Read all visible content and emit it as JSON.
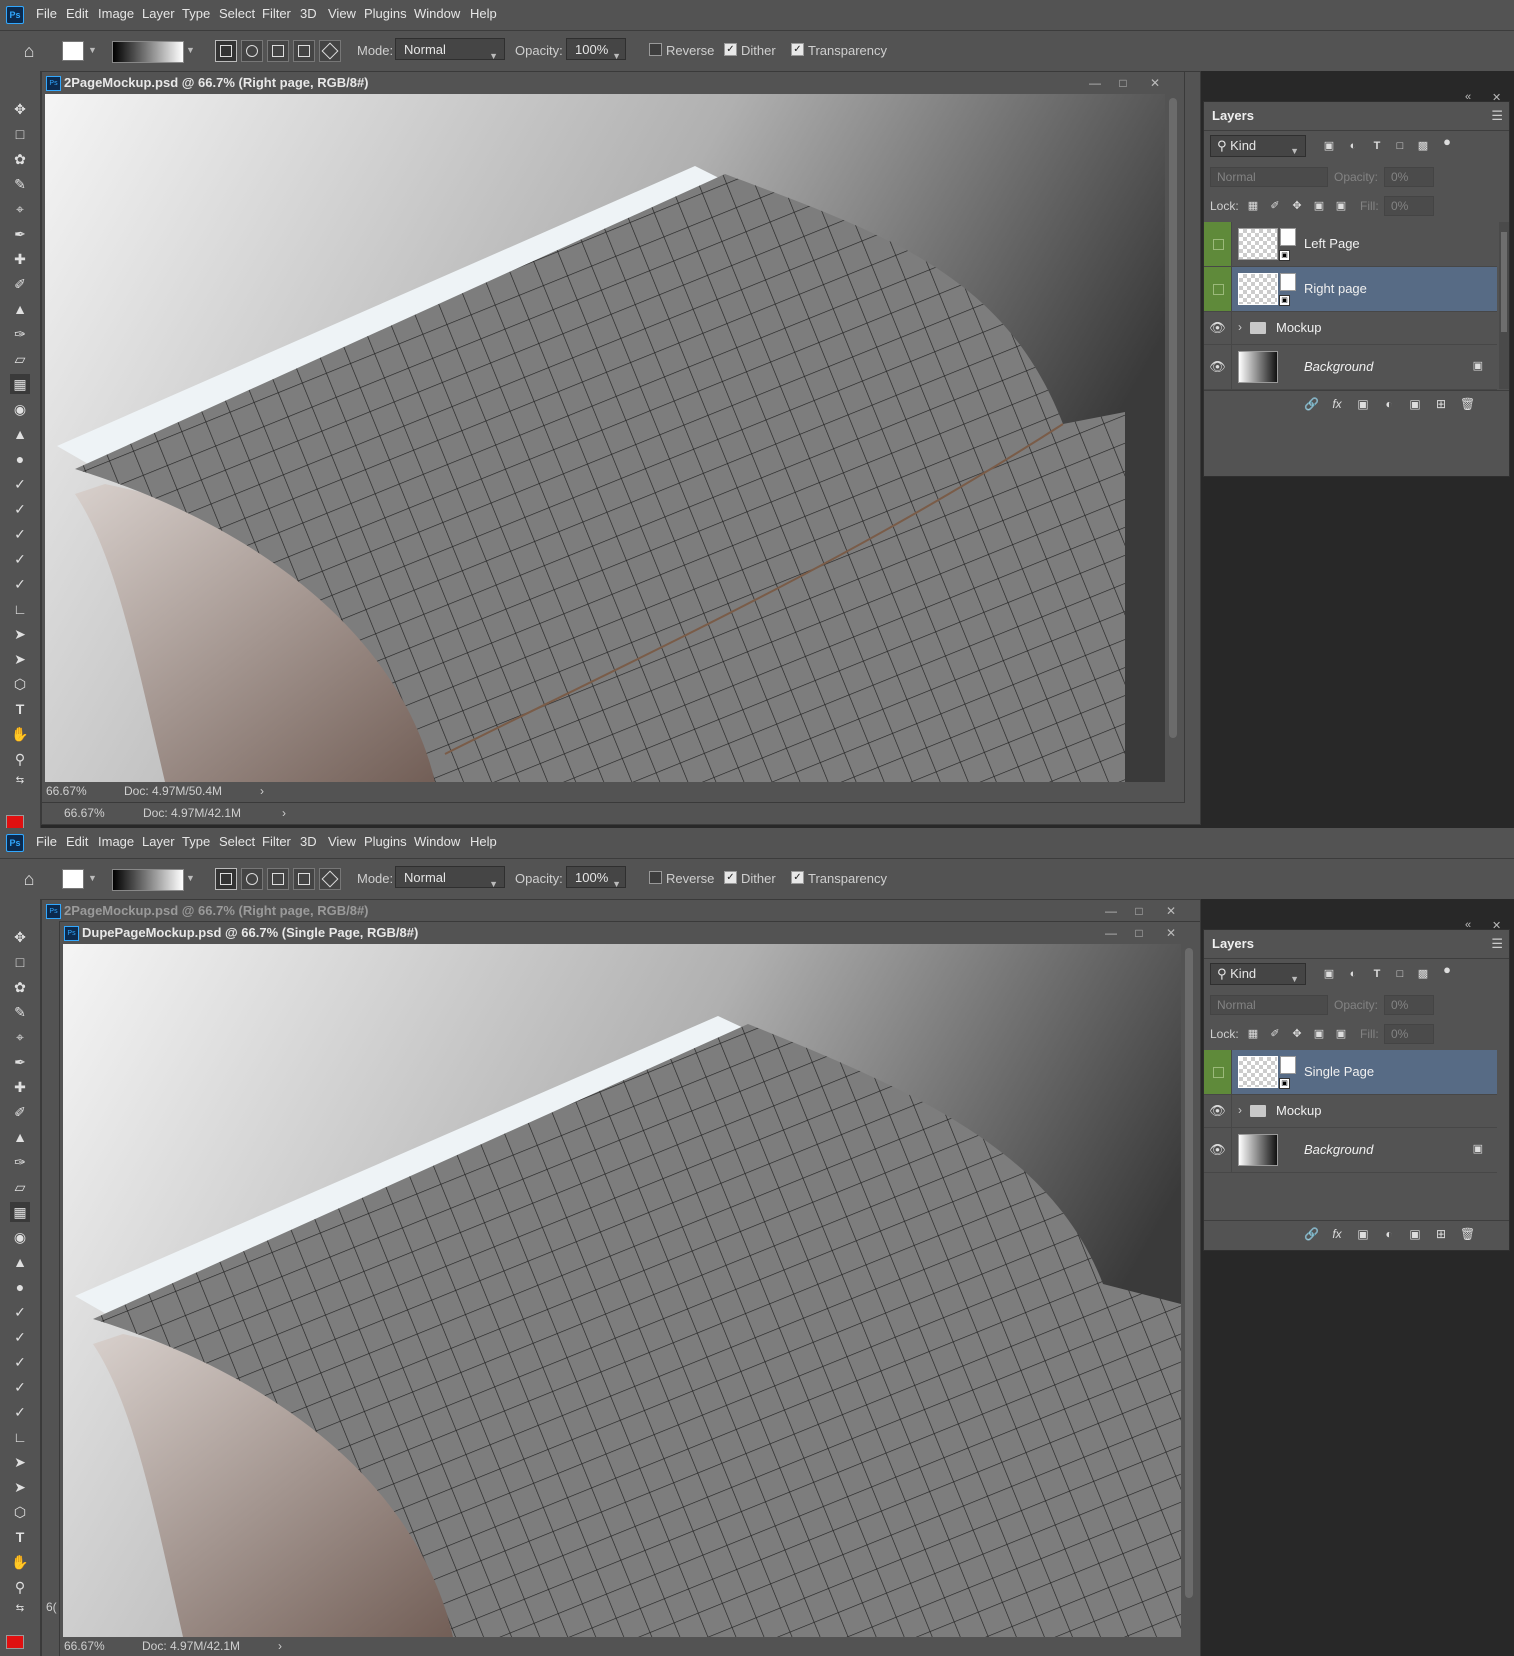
{
  "menu": [
    "File",
    "Edit",
    "Image",
    "Layer",
    "Type",
    "Select",
    "Filter",
    "3D",
    "View",
    "Plugins",
    "Window",
    "Help"
  ],
  "app_icon": "Ps",
  "options": {
    "mode_label": "Mode:",
    "mode_value": "Normal",
    "opacity_label": "Opacity:",
    "opacity_value": "100%",
    "reverse_label": "Reverse",
    "reverse_checked": false,
    "dither_label": "Dither",
    "dither_checked": true,
    "transparency_label": "Transparency",
    "transparency_checked": true
  },
  "top": {
    "doc_title": "2PageMockup.psd @ 66.7% (Right page, RGB/8#)",
    "status_zoom": "66.67%",
    "status_doc": "Doc: 4.97M/50.4M",
    "back_status_zoom": "66.67%",
    "back_status_doc": "Doc: 4.97M/42.1M",
    "layers": [
      {
        "name": "Left Page",
        "type": "smart",
        "selected": false,
        "visible_eye": false
      },
      {
        "name": "Right page",
        "type": "smart",
        "selected": true,
        "visible_eye": false
      },
      {
        "name": "Mockup",
        "type": "group",
        "selected": false,
        "visible_eye": true
      },
      {
        "name": "Background",
        "type": "background",
        "selected": false,
        "visible_eye": true
      }
    ]
  },
  "bottom": {
    "back_doc_title": "2PageMockup.psd @ 66.7% (Right page, RGB/8#)",
    "doc_title": "DupePageMockup.psd @ 66.7% (Single Page, RGB/8#)",
    "status_zoom": "66.67%",
    "status_doc": "Doc: 4.97M/42.1M",
    "back_status_zoom_partial": "6(",
    "layers": [
      {
        "name": "Single Page",
        "type": "smart",
        "selected": true,
        "visible_eye": false
      },
      {
        "name": "Mockup",
        "type": "group",
        "selected": false,
        "visible_eye": true
      },
      {
        "name": "Background",
        "type": "background",
        "selected": false,
        "visible_eye": true
      }
    ]
  },
  "layers_panel": {
    "tab": "Layers",
    "kind_label": "Kind",
    "blend_mode": "Normal",
    "opacity_label": "Opacity:",
    "opacity_value": "0%",
    "lock_label": "Lock:",
    "fill_label": "Fill:",
    "fill_value": "0%"
  },
  "icons": {
    "home": "home-icon",
    "layer_filters": [
      "image-filter-icon",
      "adjustment-filter-icon",
      "type-filter-icon",
      "shape-filter-icon",
      "smart-object-filter-icon",
      "filter-toggle-icon"
    ],
    "locks": [
      "lock-transparent-icon",
      "lock-paint-icon",
      "lock-position-icon",
      "lock-artboard-icon",
      "lock-all-icon"
    ],
    "footer": [
      "link-layers-icon",
      "fx-icon",
      "add-mask-icon",
      "adjustment-layer-icon",
      "new-group-icon",
      "new-layer-icon",
      "delete-layer-icon"
    ]
  },
  "colors": {
    "ui_bg": "#535353",
    "workspace_bg": "#282828",
    "selected_layer": "#576b85",
    "linked_green": "#5f8a3a",
    "foreground_color": "#e01010"
  }
}
